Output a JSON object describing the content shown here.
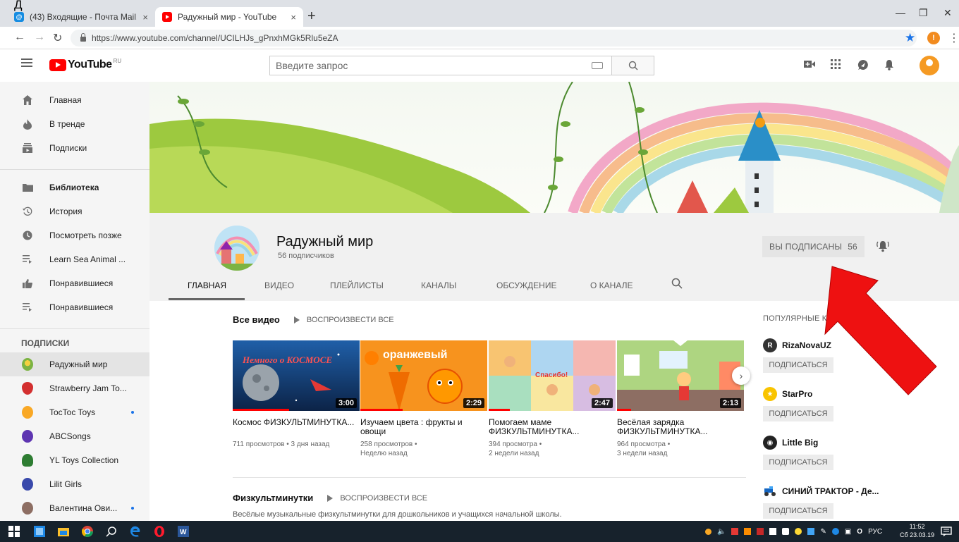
{
  "top_glyph": "Д",
  "browser": {
    "tabs": [
      {
        "title": "(43) Входящие - Почта Mail.Ru",
        "close": "×"
      },
      {
        "title": "Радужный мир - YouTube",
        "close": "×"
      }
    ],
    "new_tab": "+",
    "url": "https://www.youtube.com/channel/UCILHJs_gPnxhMGk5Rlu5eZA",
    "extension_badge": "!"
  },
  "masthead": {
    "logo_word": "YouTube",
    "logo_region": "RU",
    "search_placeholder": "Введите запрос"
  },
  "sidebar": {
    "main": [
      {
        "label": "Главная",
        "icon": "home-icon"
      },
      {
        "label": "В тренде",
        "icon": "flame-icon"
      },
      {
        "label": "Подписки",
        "icon": "subscriptions-icon"
      }
    ],
    "library": [
      {
        "label": "Библиотека",
        "icon": "folder-icon"
      },
      {
        "label": "История",
        "icon": "history-icon"
      },
      {
        "label": "Посмотреть позже",
        "icon": "clock-icon"
      },
      {
        "label": "Learn Sea Animal ...",
        "icon": "playlist-icon"
      },
      {
        "label": "Понравившиеся",
        "icon": "thumbs-up-icon"
      },
      {
        "label": "Понравившиеся",
        "icon": "playlist-icon"
      }
    ],
    "subscriptions_header": "ПОДПИСКИ",
    "subscriptions": [
      {
        "label": "Радужный мир",
        "color": "#7cb342",
        "active": true,
        "dot": false
      },
      {
        "label": "Strawberry Jam To...",
        "color": "#d32f2f",
        "active": false,
        "dot": false
      },
      {
        "label": "TocToc Toys",
        "color": "#f9a825",
        "active": false,
        "dot": true
      },
      {
        "label": "ABCSongs",
        "color": "#5e35b1",
        "active": false,
        "dot": false
      },
      {
        "label": "YL Toys Collection",
        "color": "#2e7d32",
        "active": false,
        "dot": false
      },
      {
        "label": "Lilit Girls",
        "color": "#3949ab",
        "active": false,
        "dot": false
      },
      {
        "label": "Валентина Ови...",
        "color": "#8d6e63",
        "active": false,
        "dot": true
      }
    ]
  },
  "channel": {
    "name": "Радужный мир",
    "subscribers": "56 подписчиков",
    "subscribed_label": "ВЫ ПОДПИСАНЫ",
    "subscribed_count": "56",
    "tabs": [
      "ГЛАВНАЯ",
      "ВИДЕО",
      "ПЛЕЙЛИСТЫ",
      "КАНАЛЫ",
      "ОБСУЖДЕНИЕ",
      "О КАНАЛЕ"
    ]
  },
  "rows": [
    {
      "title": "Все видео",
      "play_all": "ВОСПРОИЗВЕСТИ ВСЕ",
      "videos": [
        {
          "thumb_text": "Немного о КОСМОСЕ",
          "duration": "3:00",
          "title": "Космос ФИЗКУЛЬТМИНУТКА...",
          "meta1": "711 просмотров • 3 дня назад",
          "meta2": ""
        },
        {
          "thumb_text": "оранжевый",
          "duration": "2:29",
          "title": "Изучаем цвета : фрукты и овощи",
          "meta1": "258 просмотров •",
          "meta2": "Неделю назад"
        },
        {
          "thumb_text": "Спасибо!",
          "duration": "2:47",
          "title": "Помогаем маме ФИЗКУЛЬТМИНУТКА...",
          "meta1": "394 просмотра •",
          "meta2": "2 недели назад"
        },
        {
          "thumb_text": "",
          "duration": "2:13",
          "title": "Весёлая зарядка ФИЗКУЛЬТМИНУТКА...",
          "meta1": "964 просмотра •",
          "meta2": "3 недели назад"
        }
      ]
    },
    {
      "title": "Физкультминутки",
      "play_all": "ВОСПРОИЗВЕСТИ ВСЕ",
      "description": "Весёлые музыкальные физкультминутки для дошкольников и учащихся начальной школы."
    }
  ],
  "popular": {
    "header": "ПОПУЛЯРНЫЕ КАНАЛ",
    "button_label": "ПОДПИСАТЬСЯ",
    "channels": [
      {
        "name": "RizaNovaUZ",
        "initial": "R",
        "color": "#333333"
      },
      {
        "name": "StarPro",
        "initial": "",
        "color": "#f9c400"
      },
      {
        "name": "Little Big",
        "initial": "",
        "color": "#222222"
      },
      {
        "name": "СИНИЙ ТРАКТОР - Де...",
        "initial": "",
        "color": "#1565c0"
      }
    ]
  },
  "taskbar": {
    "lang": "РУС",
    "time": "11:52",
    "date": "Сб 23.03.19"
  },
  "colors": {
    "youtube_red": "#ff0000",
    "arrow_red": "#ee1111",
    "progress_red": "#ff0000"
  }
}
